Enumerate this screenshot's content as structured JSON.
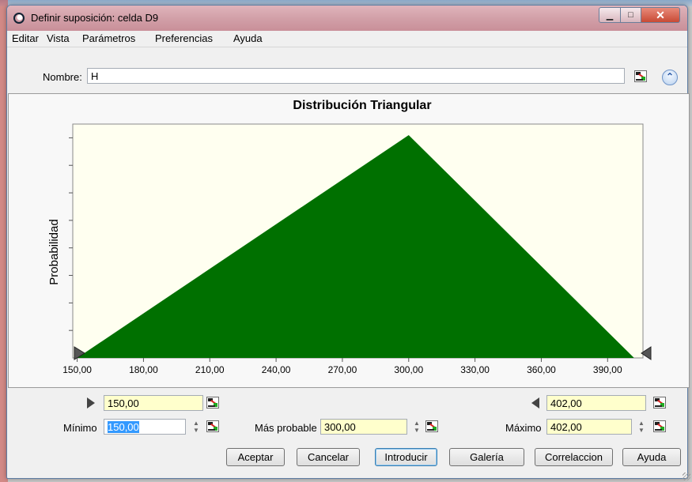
{
  "window": {
    "title": "Definir suposición: celda D9"
  },
  "menu": [
    "Editar",
    "Vista",
    "Parámetros",
    "Preferencias",
    "Ayuda"
  ],
  "name_field": {
    "label": "Nombre:",
    "value": "H"
  },
  "chart_data": {
    "type": "area",
    "title": "Distribución Triangular",
    "xlabel": "",
    "ylabel": "Probabilidad",
    "x_ticks": [
      "150,00",
      "180,00",
      "210,00",
      "240,00",
      "270,00",
      "300,00",
      "330,00",
      "360,00",
      "390,00"
    ],
    "xlim": [
      148,
      406
    ],
    "x": [
      150,
      300,
      402
    ],
    "y": [
      0,
      1,
      0
    ],
    "fill_color": "#007000",
    "plot_bg": "#fffff0",
    "grid": false
  },
  "params": {
    "lower_bound": "150,00",
    "upper_bound": "402,00",
    "min_label": "Mínimo",
    "min_value": "150,00",
    "likely_label": "Más probable",
    "likely_value": "300,00",
    "max_label": "Máximo",
    "max_value": "402,00"
  },
  "buttons": {
    "accept": "Aceptar",
    "cancel": "Cancelar",
    "enter": "Introducir",
    "gallery": "Galería",
    "correlation": "Correlaccion",
    "help": "Ayuda"
  },
  "colors": {
    "accent": "#3399ff",
    "field_bg": "#ffffcc",
    "title_bar": "#d2a0a8"
  }
}
